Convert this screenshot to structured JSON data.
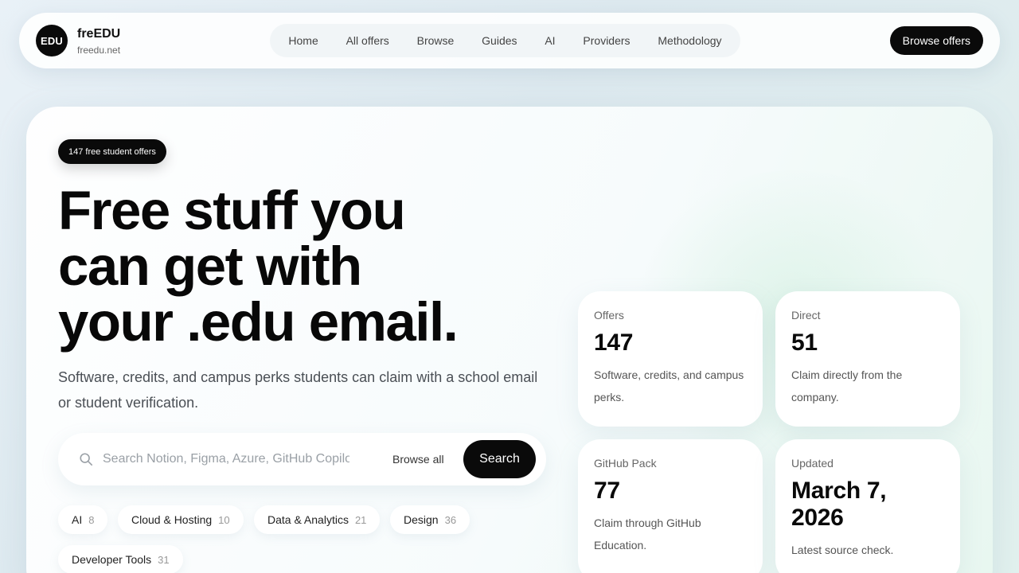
{
  "header": {
    "logo_text": "EDU",
    "brand_name": "freEDU",
    "brand_domain": "freedu.net",
    "nav": [
      "Home",
      "All offers",
      "Browse",
      "Guides",
      "AI",
      "Providers",
      "Methodology"
    ],
    "cta_label": "Browse offers"
  },
  "hero": {
    "badge": "147 free student offers",
    "headline_lines": [
      "Free stuff you",
      "can get with",
      "your .edu email."
    ],
    "subtext": "Software, credits, and campus perks students can claim with a school email or student verification.",
    "search": {
      "placeholder": "Search Notion, Figma, Azure, GitHub Copilot...",
      "browse_all_label": "Browse all",
      "button_label": "Search"
    },
    "categories": [
      {
        "name": "AI",
        "count": "8"
      },
      {
        "name": "Cloud & Hosting",
        "count": "10"
      },
      {
        "name": "Data & Analytics",
        "count": "21"
      },
      {
        "name": "Design",
        "count": "36"
      },
      {
        "name": "Developer Tools",
        "count": "31"
      }
    ]
  },
  "stats": [
    {
      "label": "Offers",
      "value": "147",
      "desc": "Software, credits, and campus perks."
    },
    {
      "label": "Direct",
      "value": "51",
      "desc": "Claim directly from the company."
    },
    {
      "label": "GitHub Pack",
      "value": "77",
      "desc": "Claim through GitHub Education."
    },
    {
      "label": "Updated",
      "value": "March 7, 2026",
      "desc": "Latest source check."
    }
  ],
  "colors": {
    "accent": "#0a0a0a",
    "background": "#e4eef3"
  }
}
